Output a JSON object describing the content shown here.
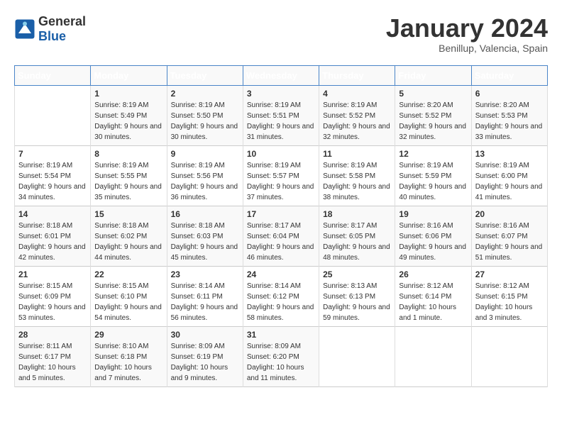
{
  "header": {
    "logo_general": "General",
    "logo_blue": "Blue",
    "month_title": "January 2024",
    "subtitle": "Benillup, Valencia, Spain"
  },
  "days_of_week": [
    "Sunday",
    "Monday",
    "Tuesday",
    "Wednesday",
    "Thursday",
    "Friday",
    "Saturday"
  ],
  "weeks": [
    [
      {
        "day": "",
        "sunrise": "",
        "sunset": "",
        "daylight": ""
      },
      {
        "day": "1",
        "sunrise": "Sunrise: 8:19 AM",
        "sunset": "Sunset: 5:49 PM",
        "daylight": "Daylight: 9 hours and 30 minutes."
      },
      {
        "day": "2",
        "sunrise": "Sunrise: 8:19 AM",
        "sunset": "Sunset: 5:50 PM",
        "daylight": "Daylight: 9 hours and 30 minutes."
      },
      {
        "day": "3",
        "sunrise": "Sunrise: 8:19 AM",
        "sunset": "Sunset: 5:51 PM",
        "daylight": "Daylight: 9 hours and 31 minutes."
      },
      {
        "day": "4",
        "sunrise": "Sunrise: 8:19 AM",
        "sunset": "Sunset: 5:52 PM",
        "daylight": "Daylight: 9 hours and 32 minutes."
      },
      {
        "day": "5",
        "sunrise": "Sunrise: 8:20 AM",
        "sunset": "Sunset: 5:52 PM",
        "daylight": "Daylight: 9 hours and 32 minutes."
      },
      {
        "day": "6",
        "sunrise": "Sunrise: 8:20 AM",
        "sunset": "Sunset: 5:53 PM",
        "daylight": "Daylight: 9 hours and 33 minutes."
      }
    ],
    [
      {
        "day": "7",
        "sunrise": "Sunrise: 8:19 AM",
        "sunset": "Sunset: 5:54 PM",
        "daylight": "Daylight: 9 hours and 34 minutes."
      },
      {
        "day": "8",
        "sunrise": "Sunrise: 8:19 AM",
        "sunset": "Sunset: 5:55 PM",
        "daylight": "Daylight: 9 hours and 35 minutes."
      },
      {
        "day": "9",
        "sunrise": "Sunrise: 8:19 AM",
        "sunset": "Sunset: 5:56 PM",
        "daylight": "Daylight: 9 hours and 36 minutes."
      },
      {
        "day": "10",
        "sunrise": "Sunrise: 8:19 AM",
        "sunset": "Sunset: 5:57 PM",
        "daylight": "Daylight: 9 hours and 37 minutes."
      },
      {
        "day": "11",
        "sunrise": "Sunrise: 8:19 AM",
        "sunset": "Sunset: 5:58 PM",
        "daylight": "Daylight: 9 hours and 38 minutes."
      },
      {
        "day": "12",
        "sunrise": "Sunrise: 8:19 AM",
        "sunset": "Sunset: 5:59 PM",
        "daylight": "Daylight: 9 hours and 40 minutes."
      },
      {
        "day": "13",
        "sunrise": "Sunrise: 8:19 AM",
        "sunset": "Sunset: 6:00 PM",
        "daylight": "Daylight: 9 hours and 41 minutes."
      }
    ],
    [
      {
        "day": "14",
        "sunrise": "Sunrise: 8:18 AM",
        "sunset": "Sunset: 6:01 PM",
        "daylight": "Daylight: 9 hours and 42 minutes."
      },
      {
        "day": "15",
        "sunrise": "Sunrise: 8:18 AM",
        "sunset": "Sunset: 6:02 PM",
        "daylight": "Daylight: 9 hours and 44 minutes."
      },
      {
        "day": "16",
        "sunrise": "Sunrise: 8:18 AM",
        "sunset": "Sunset: 6:03 PM",
        "daylight": "Daylight: 9 hours and 45 minutes."
      },
      {
        "day": "17",
        "sunrise": "Sunrise: 8:17 AM",
        "sunset": "Sunset: 6:04 PM",
        "daylight": "Daylight: 9 hours and 46 minutes."
      },
      {
        "day": "18",
        "sunrise": "Sunrise: 8:17 AM",
        "sunset": "Sunset: 6:05 PM",
        "daylight": "Daylight: 9 hours and 48 minutes."
      },
      {
        "day": "19",
        "sunrise": "Sunrise: 8:16 AM",
        "sunset": "Sunset: 6:06 PM",
        "daylight": "Daylight: 9 hours and 49 minutes."
      },
      {
        "day": "20",
        "sunrise": "Sunrise: 8:16 AM",
        "sunset": "Sunset: 6:07 PM",
        "daylight": "Daylight: 9 hours and 51 minutes."
      }
    ],
    [
      {
        "day": "21",
        "sunrise": "Sunrise: 8:15 AM",
        "sunset": "Sunset: 6:09 PM",
        "daylight": "Daylight: 9 hours and 53 minutes."
      },
      {
        "day": "22",
        "sunrise": "Sunrise: 8:15 AM",
        "sunset": "Sunset: 6:10 PM",
        "daylight": "Daylight: 9 hours and 54 minutes."
      },
      {
        "day": "23",
        "sunrise": "Sunrise: 8:14 AM",
        "sunset": "Sunset: 6:11 PM",
        "daylight": "Daylight: 9 hours and 56 minutes."
      },
      {
        "day": "24",
        "sunrise": "Sunrise: 8:14 AM",
        "sunset": "Sunset: 6:12 PM",
        "daylight": "Daylight: 9 hours and 58 minutes."
      },
      {
        "day": "25",
        "sunrise": "Sunrise: 8:13 AM",
        "sunset": "Sunset: 6:13 PM",
        "daylight": "Daylight: 9 hours and 59 minutes."
      },
      {
        "day": "26",
        "sunrise": "Sunrise: 8:12 AM",
        "sunset": "Sunset: 6:14 PM",
        "daylight": "Daylight: 10 hours and 1 minute."
      },
      {
        "day": "27",
        "sunrise": "Sunrise: 8:12 AM",
        "sunset": "Sunset: 6:15 PM",
        "daylight": "Daylight: 10 hours and 3 minutes."
      }
    ],
    [
      {
        "day": "28",
        "sunrise": "Sunrise: 8:11 AM",
        "sunset": "Sunset: 6:17 PM",
        "daylight": "Daylight: 10 hours and 5 minutes."
      },
      {
        "day": "29",
        "sunrise": "Sunrise: 8:10 AM",
        "sunset": "Sunset: 6:18 PM",
        "daylight": "Daylight: 10 hours and 7 minutes."
      },
      {
        "day": "30",
        "sunrise": "Sunrise: 8:09 AM",
        "sunset": "Sunset: 6:19 PM",
        "daylight": "Daylight: 10 hours and 9 minutes."
      },
      {
        "day": "31",
        "sunrise": "Sunrise: 8:09 AM",
        "sunset": "Sunset: 6:20 PM",
        "daylight": "Daylight: 10 hours and 11 minutes."
      },
      {
        "day": "",
        "sunrise": "",
        "sunset": "",
        "daylight": ""
      },
      {
        "day": "",
        "sunrise": "",
        "sunset": "",
        "daylight": ""
      },
      {
        "day": "",
        "sunrise": "",
        "sunset": "",
        "daylight": ""
      }
    ]
  ]
}
